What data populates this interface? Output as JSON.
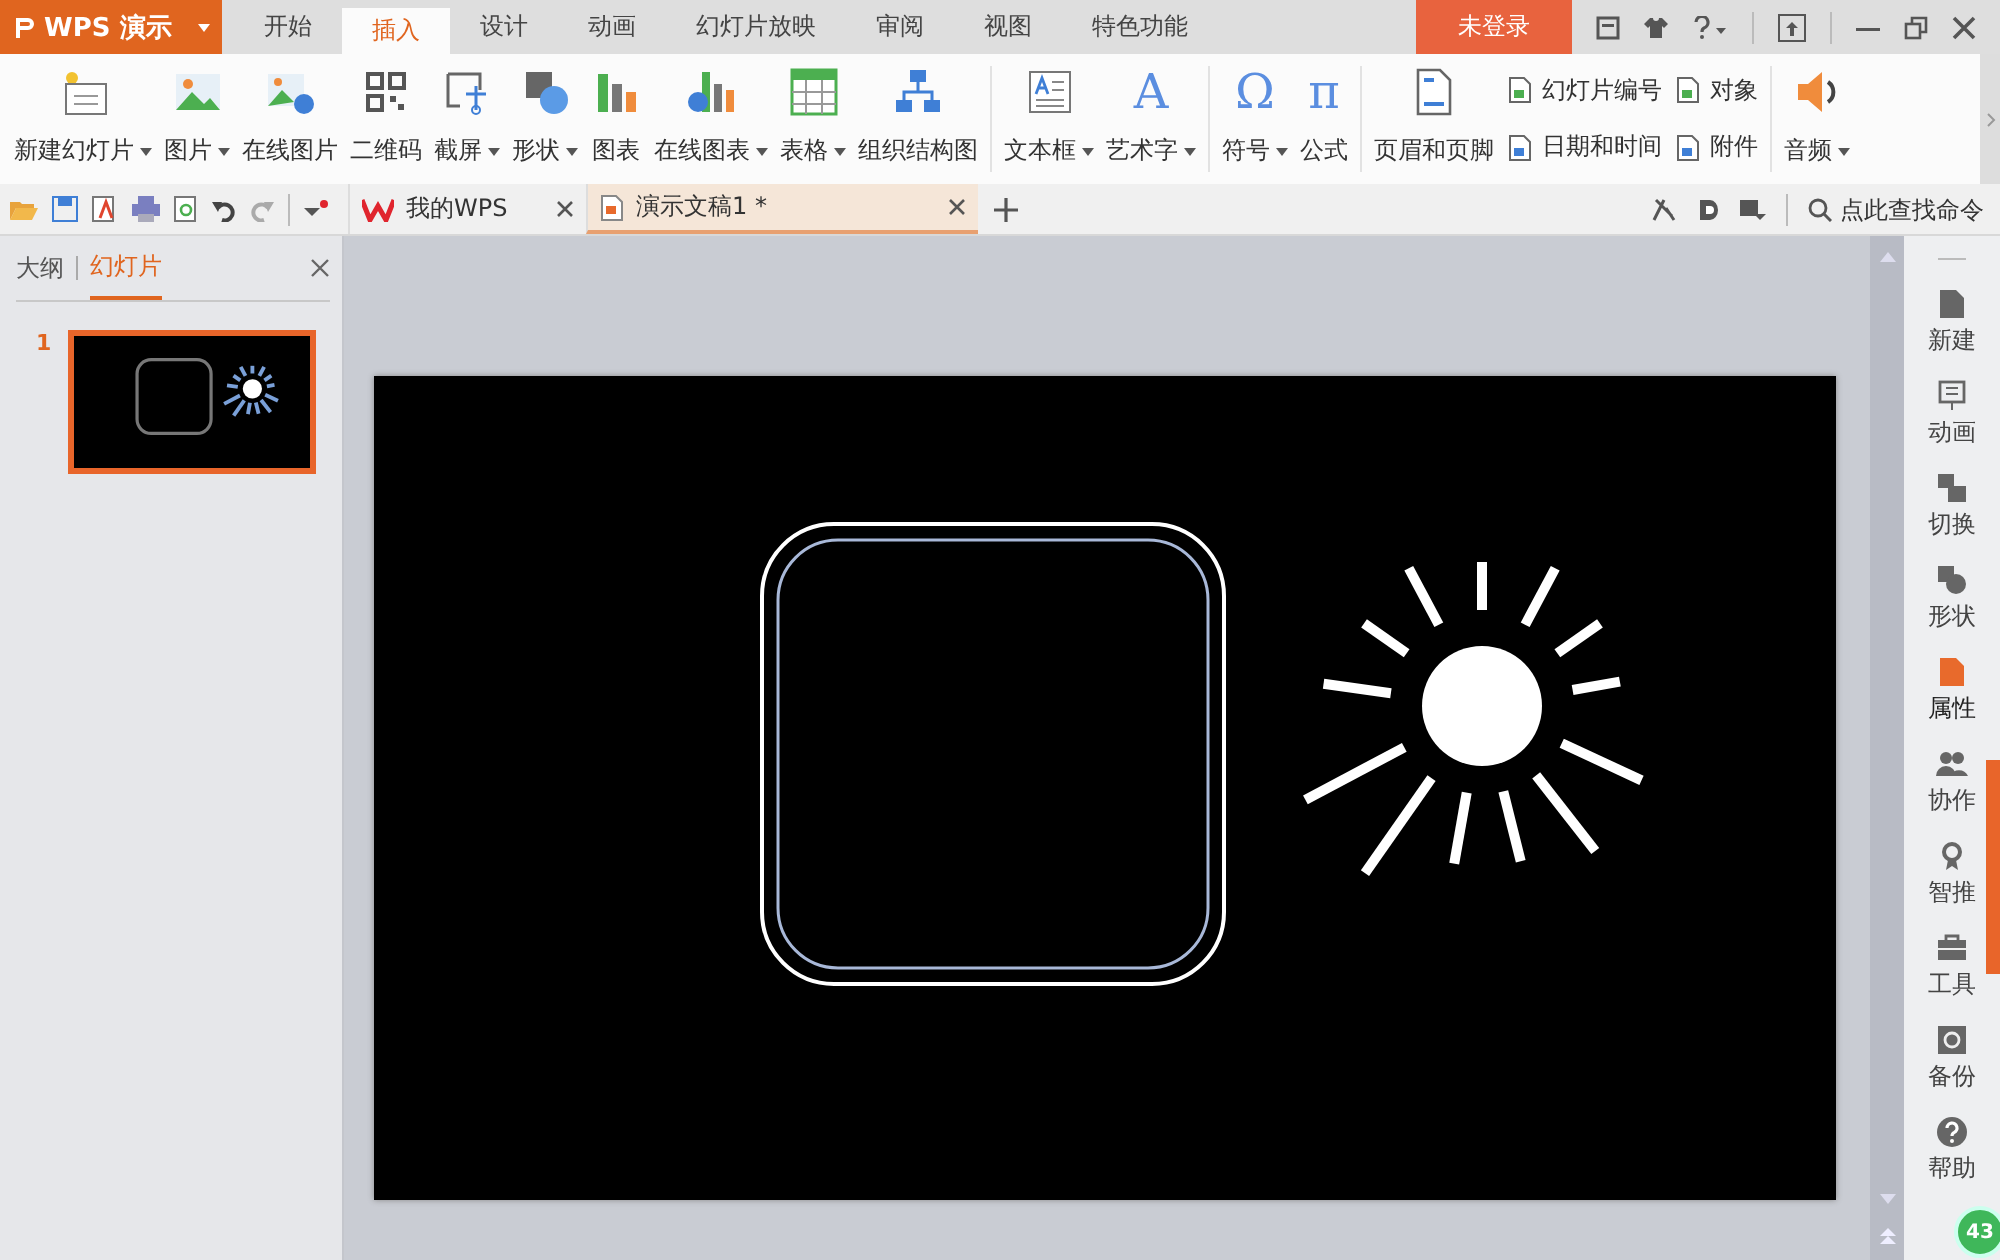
{
  "app": {
    "logo": "WPS 演示",
    "login": "未登录"
  },
  "menu_tabs": [
    {
      "label": "开始",
      "selected": false
    },
    {
      "label": "插入",
      "selected": true
    },
    {
      "label": "设计",
      "selected": false
    },
    {
      "label": "动画",
      "selected": false
    },
    {
      "label": "幻灯片放映",
      "selected": false
    },
    {
      "label": "审阅",
      "selected": false
    },
    {
      "label": "视图",
      "selected": false
    },
    {
      "label": "特色功能",
      "selected": false
    }
  ],
  "ribbon": {
    "groups": [
      {
        "items": [
          {
            "kind": "large",
            "label": "新建幻灯片",
            "has_menu": true
          },
          {
            "kind": "large",
            "label": "图片",
            "has_menu": true
          },
          {
            "kind": "large",
            "label": "在线图片",
            "has_menu": false
          },
          {
            "kind": "large",
            "label": "二维码",
            "has_menu": false
          },
          {
            "kind": "large",
            "label": "截屏",
            "has_menu": true
          },
          {
            "kind": "large",
            "label": "形状",
            "has_menu": true
          },
          {
            "kind": "large",
            "label": "图表",
            "has_menu": false
          },
          {
            "kind": "large",
            "label": "在线图表",
            "has_menu": true
          },
          {
            "kind": "large",
            "label": "表格",
            "has_menu": true
          },
          {
            "kind": "large",
            "label": "组织结构图",
            "has_menu": false
          }
        ]
      },
      {
        "items": [
          {
            "kind": "large",
            "label": "文本框",
            "has_menu": true
          },
          {
            "kind": "large",
            "label": "艺术字",
            "has_menu": true,
            "glyph": "A"
          }
        ]
      },
      {
        "items": [
          {
            "kind": "large",
            "label": "符号",
            "has_menu": true,
            "glyph": "Ω"
          },
          {
            "kind": "large",
            "label": "公式",
            "has_menu": false,
            "glyph": "π"
          }
        ]
      },
      {
        "items": [
          {
            "kind": "large",
            "label": "页眉和页脚",
            "has_menu": false
          },
          {
            "kind": "stack",
            "entries": [
              "幻灯片编号",
              "日期和时间"
            ]
          },
          {
            "kind": "stack",
            "entries": [
              "对象",
              "附件"
            ]
          }
        ]
      },
      {
        "items": [
          {
            "kind": "large",
            "label": "音频",
            "has_menu": true
          }
        ]
      }
    ]
  },
  "doc_tabs": [
    {
      "label": "我的WPS",
      "selected": false
    },
    {
      "label": "演示文稿1 *",
      "selected": true
    }
  ],
  "search": {
    "placeholder": "点此查找命令"
  },
  "left_panel": {
    "tabs": [
      {
        "label": "大纲",
        "selected": false
      },
      {
        "label": "幻灯片",
        "selected": true
      }
    ],
    "slides": [
      {
        "number": "1",
        "selected": true
      }
    ]
  },
  "right_sidebar": [
    {
      "label": "新建",
      "selected": false
    },
    {
      "label": "动画",
      "selected": false
    },
    {
      "label": "切换",
      "selected": false
    },
    {
      "label": "形状",
      "selected": false
    },
    {
      "label": "属性",
      "selected": true
    },
    {
      "label": "协作",
      "selected": false
    },
    {
      "label": "智推",
      "selected": false
    },
    {
      "label": "工具",
      "selected": false
    },
    {
      "label": "备份",
      "selected": false
    },
    {
      "label": "帮助",
      "selected": false
    }
  ],
  "badge": "43"
}
